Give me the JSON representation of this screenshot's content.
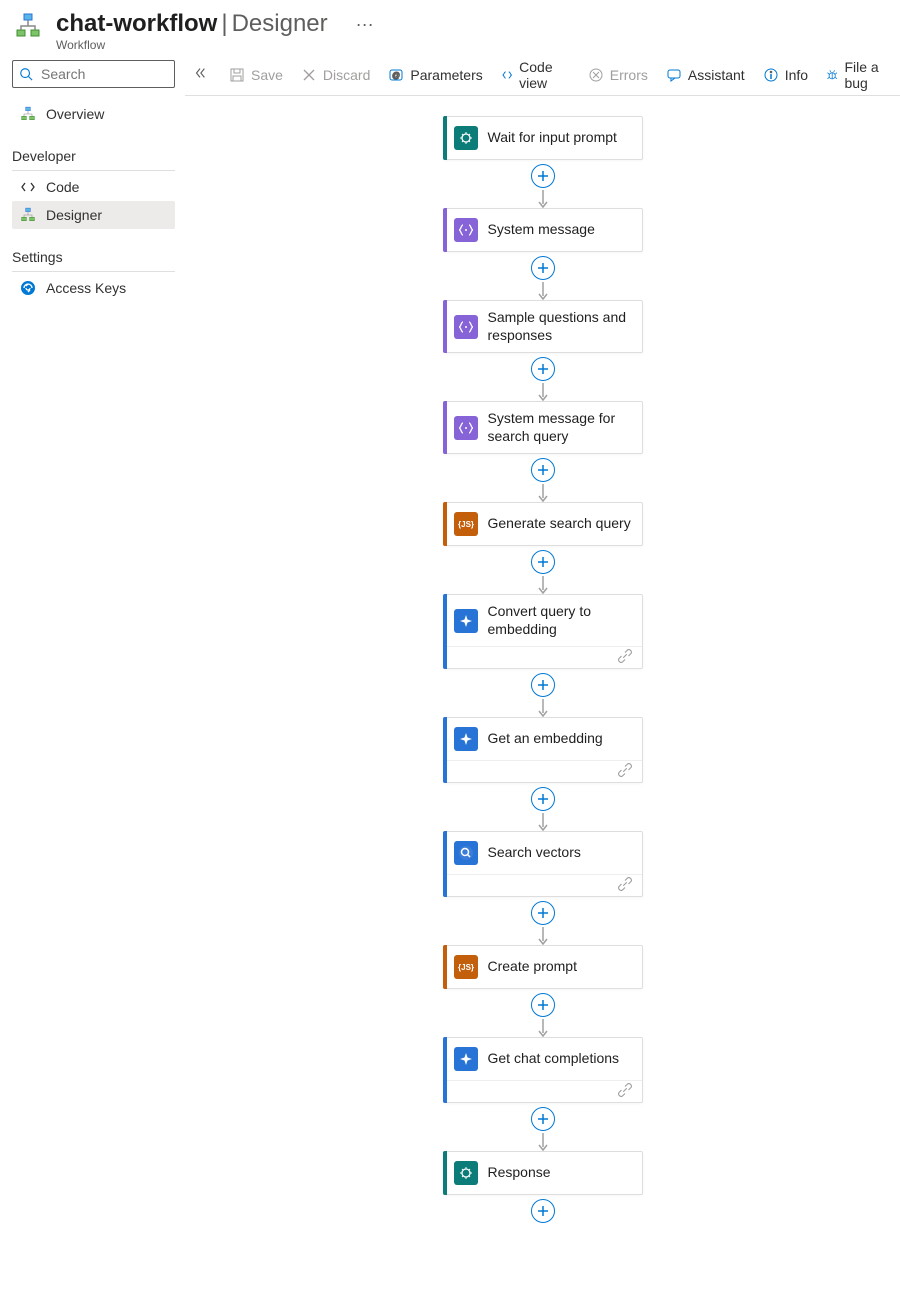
{
  "header": {
    "title_main": "chat-workflow",
    "title_section": "Designer",
    "subtitle": "Workflow"
  },
  "sidebar": {
    "search_placeholder": "Search",
    "items": [
      {
        "label": "Overview"
      }
    ],
    "group_developer_label": "Developer",
    "dev_items": [
      {
        "label": "Code"
      },
      {
        "label": "Designer",
        "selected": true
      }
    ],
    "group_settings_label": "Settings",
    "settings_items": [
      {
        "label": "Access Keys"
      }
    ]
  },
  "toolbar": {
    "save": "Save",
    "discard": "Discard",
    "parameters": "Parameters",
    "code_view": "Code view",
    "errors": "Errors",
    "assistant": "Assistant",
    "info": "Info",
    "file_bug": "File a bug"
  },
  "nodes": [
    {
      "label": "Wait for input prompt",
      "color": "teal",
      "footer": false
    },
    {
      "label": "System message",
      "color": "purple",
      "footer": false
    },
    {
      "label": "Sample questions and responses",
      "color": "purple",
      "footer": false
    },
    {
      "label": "System message for search query",
      "color": "purple",
      "footer": false
    },
    {
      "label": "Generate search query",
      "color": "orange",
      "footer": false
    },
    {
      "label": "Convert query to embedding",
      "color": "blue",
      "footer": true
    },
    {
      "label": "Get an embedding",
      "color": "blue",
      "footer": true
    },
    {
      "label": "Search vectors",
      "color": "blue",
      "footer": true,
      "icon": "search"
    },
    {
      "label": "Create prompt",
      "color": "orange",
      "footer": false
    },
    {
      "label": "Get chat completions",
      "color": "blue",
      "footer": true
    },
    {
      "label": "Response",
      "color": "teal",
      "footer": false
    }
  ]
}
